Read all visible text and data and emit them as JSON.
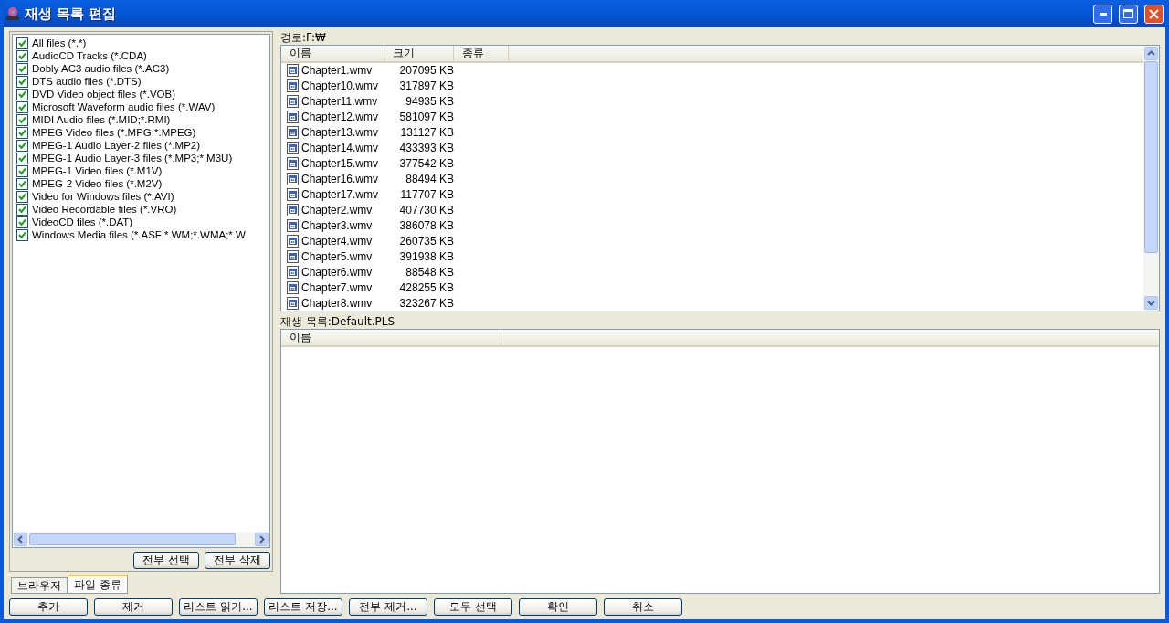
{
  "window": {
    "title": "재생 목록 편집"
  },
  "file_types": [
    {
      "label": "All files (*.*)",
      "checked": true
    },
    {
      "label": "AudioCD Tracks (*.CDA)",
      "checked": true
    },
    {
      "label": "Dobly AC3 audio files (*.AC3)",
      "checked": true
    },
    {
      "label": "DTS audio files (*.DTS)",
      "checked": true
    },
    {
      "label": "DVD Video object files (*.VOB)",
      "checked": true
    },
    {
      "label": "Microsoft Waveform audio files (*.WAV)",
      "checked": true
    },
    {
      "label": "MIDI Audio files (*.MID;*.RMI)",
      "checked": true
    },
    {
      "label": "MPEG Video files (*.MPG;*.MPEG)",
      "checked": true
    },
    {
      "label": "MPEG-1 Audio Layer-2 files (*.MP2)",
      "checked": true
    },
    {
      "label": "MPEG-1 Audio Layer-3 files (*.MP3;*.M3U)",
      "checked": true
    },
    {
      "label": "MPEG-1 Video files (*.M1V)",
      "checked": true
    },
    {
      "label": "MPEG-2 Video files (*.M2V)",
      "checked": true
    },
    {
      "label": "Video for Windows files (*.AVI)",
      "checked": true
    },
    {
      "label": "Video Recordable files (*.VRO)",
      "checked": true
    },
    {
      "label": "VideoCD files (*.DAT)",
      "checked": true
    },
    {
      "label": "Windows Media files (*.ASF;*.WM;*.WMA;*.W",
      "checked": true
    }
  ],
  "left_buttons": [
    "전부 선택",
    "전부 삭제"
  ],
  "tabs": [
    {
      "label": "브라우저",
      "selected": false
    },
    {
      "label": "파일 종류",
      "selected": true
    }
  ],
  "path_label": "경로:F:₩",
  "files_table": {
    "columns": [
      "이름",
      "크기",
      "종류"
    ],
    "rows": [
      {
        "name": "Chapter1.wmv",
        "size": "207095 KB"
      },
      {
        "name": "Chapter10.wmv",
        "size": "317897 KB"
      },
      {
        "name": "Chapter11.wmv",
        "size": "94935 KB"
      },
      {
        "name": "Chapter12.wmv",
        "size": "581097 KB"
      },
      {
        "name": "Chapter13.wmv",
        "size": "131127 KB"
      },
      {
        "name": "Chapter14.wmv",
        "size": "433393 KB"
      },
      {
        "name": "Chapter15.wmv",
        "size": "377542 KB"
      },
      {
        "name": "Chapter16.wmv",
        "size": "88494 KB"
      },
      {
        "name": "Chapter17.wmv",
        "size": "117707 KB"
      },
      {
        "name": "Chapter2.wmv",
        "size": "407730 KB"
      },
      {
        "name": "Chapter3.wmv",
        "size": "386078 KB"
      },
      {
        "name": "Chapter4.wmv",
        "size": "260735 KB"
      },
      {
        "name": "Chapter5.wmv",
        "size": "391938 KB"
      },
      {
        "name": "Chapter6.wmv",
        "size": "88548 KB"
      },
      {
        "name": "Chapter7.wmv",
        "size": "428255 KB"
      },
      {
        "name": "Chapter8.wmv",
        "size": "323267 KB"
      }
    ]
  },
  "playlist_label": "재생 목록:Default.PLS",
  "playlist_table": {
    "columns": [
      "이름"
    ]
  },
  "bottom_buttons": [
    "추가",
    "제거",
    "리스트 읽기...",
    "리스트 저장...",
    "전부 제거...",
    "모두 선택",
    "확인",
    "취소"
  ]
}
